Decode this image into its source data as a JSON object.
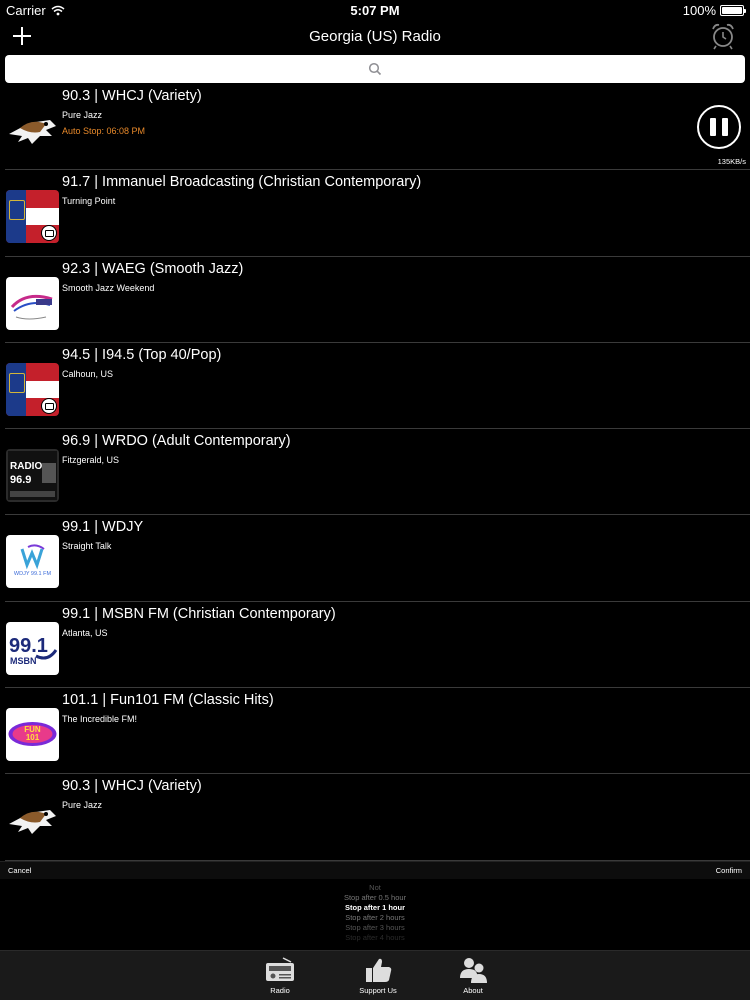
{
  "status_bar": {
    "carrier": "Carrier",
    "time": "5:07 PM",
    "battery": "100%"
  },
  "nav": {
    "title": "Georgia (US) Radio",
    "add_icon": "plus-icon",
    "alarm_icon": "alarm-clock-icon"
  },
  "search": {
    "placeholder": "",
    "icon": "search-icon"
  },
  "now_playing": {
    "autostop": "Auto Stop: 06:08 PM",
    "bitrate": "135KB/s",
    "state": "playing"
  },
  "stations": [
    {
      "name": "90.3 | WHCJ (Variety)",
      "subtitle": "Pure Jazz",
      "logo": "eagle-logo"
    },
    {
      "name": "91.7 | Immanuel Broadcasting (Christian Contemporary)",
      "subtitle": "Turning Point",
      "logo": "georgia-flag-logo"
    },
    {
      "name": "92.3 | WAEG (Smooth Jazz)",
      "subtitle": "Smooth Jazz Weekend",
      "logo": "smooth-jazz-logo"
    },
    {
      "name": "94.5 | I94.5 (Top 40/Pop)",
      "subtitle": "Calhoun, US",
      "logo": "georgia-flag-logo"
    },
    {
      "name": "96.9 | WRDO (Adult Contemporary)",
      "subtitle": "Fitzgerald, US",
      "logo": "radio-969-logo",
      "logo_text": "RADIO 96.9"
    },
    {
      "name": "99.1 | WDJY",
      "subtitle": "Straight Talk",
      "logo": "wdjy-logo",
      "logo_text": "WDJY 99.1 FM"
    },
    {
      "name": "99.1 | MSBN FM (Christian Contemporary)",
      "subtitle": "Atlanta, US",
      "logo": "msbn-logo",
      "logo_text": "99.1 MSBN"
    },
    {
      "name": "101.1 | Fun101 FM (Classic Hits)",
      "subtitle": "The Incredible FM!",
      "logo": "fun101-logo",
      "logo_text": "FUN 101"
    },
    {
      "name": "90.3 | WHCJ (Variety)",
      "subtitle": "Pure Jazz",
      "logo": "eagle-logo"
    }
  ],
  "picker": {
    "cancel": "Cancel",
    "confirm": "Confirm",
    "options": [
      "Not",
      "Stop after 0.5 hour",
      "Stop after 1 hour",
      "Stop after 2 hours",
      "Stop after 3 hours",
      "Stop after 4 hours"
    ],
    "selected_index": 2
  },
  "tabs": [
    {
      "label": "Radio",
      "icon": "radio-icon"
    },
    {
      "label": "Support Us",
      "icon": "thumbs-up-icon"
    },
    {
      "label": "About",
      "icon": "people-icon"
    }
  ],
  "colors": {
    "background": "#000000",
    "autostop": "#e8892a",
    "separator": "#3a3a3a"
  }
}
